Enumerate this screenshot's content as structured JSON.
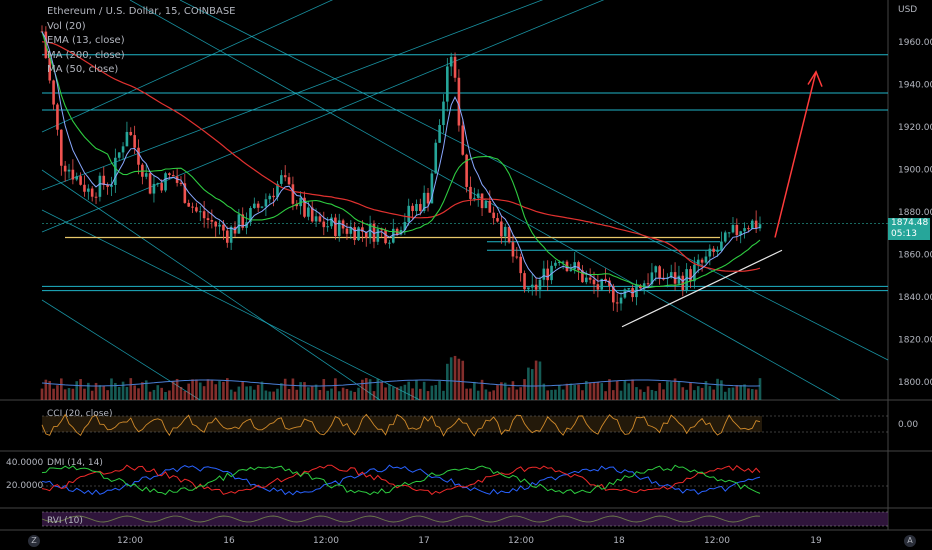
{
  "legend": {
    "symbol": "Ethereum / U.S. Dollar, 15, COINBASE",
    "vol": "Vol (20)",
    "ema": "EMA (13, close)",
    "ma200": "MA (200, close)",
    "ma50": "MA (50, close)"
  },
  "indicators": {
    "cci": "CCI (20, close)",
    "dmi": "DMI (14, 14)",
    "rvi": "RVI (10)",
    "cci_value": "0.00",
    "dmi_top": "40.0000",
    "dmi_mid": "20.0000"
  },
  "price_tag": {
    "price": "1874.48",
    "countdown": "05:13"
  },
  "corner_left": "Z",
  "corner_right": "A",
  "colors": {
    "up": "#26a69a",
    "down": "#ef5350",
    "ema": "#89a8ff",
    "ma200": "#e0312f",
    "ma50": "#2ecc40",
    "channel": "#1fb5c8",
    "support": "#e8c86a",
    "arrow": "#ff3b3b"
  },
  "chart_data": {
    "type": "candlestick",
    "title": "Ethereum / U.S. Dollar, 15, COINBASE",
    "currency": "USD",
    "y_ticks": [
      1960,
      1940,
      1920,
      1900,
      1880,
      1860,
      1840,
      1820,
      1800
    ],
    "ylim": [
      1790,
      1968
    ],
    "x_ticks": [
      "12:00",
      "16",
      "12:00",
      "17",
      "12:00",
      "18",
      "12:00",
      "19"
    ],
    "last_price": 1874.48,
    "approx_path": [
      {
        "t": 0,
        "price": 1965
      },
      {
        "t": 5,
        "price": 1905
      },
      {
        "t": 12,
        "price": 1890
      },
      {
        "t": 18,
        "price": 1895
      },
      {
        "t": 22,
        "price": 1920
      },
      {
        "t": 28,
        "price": 1892
      },
      {
        "t": 34,
        "price": 1897
      },
      {
        "t": 40,
        "price": 1880
      },
      {
        "t": 48,
        "price": 1870
      },
      {
        "t": 55,
        "price": 1880
      },
      {
        "t": 62,
        "price": 1895
      },
      {
        "t": 70,
        "price": 1875
      },
      {
        "t": 80,
        "price": 1872
      },
      {
        "t": 90,
        "price": 1870
      },
      {
        "t": 100,
        "price": 1888
      },
      {
        "t": 106,
        "price": 1955
      },
      {
        "t": 110,
        "price": 1893
      },
      {
        "t": 118,
        "price": 1878
      },
      {
        "t": 126,
        "price": 1840
      },
      {
        "t": 134,
        "price": 1860
      },
      {
        "t": 142,
        "price": 1846
      },
      {
        "t": 150,
        "price": 1840
      },
      {
        "t": 158,
        "price": 1850
      },
      {
        "t": 166,
        "price": 1848
      },
      {
        "t": 174,
        "price": 1860
      },
      {
        "t": 182,
        "price": 1875
      },
      {
        "t": 186,
        "price": 1874.48
      }
    ],
    "horizontal_levels": [
      1954,
      1936,
      1928,
      1845,
      1843
    ],
    "support_level": 1868,
    "resistance_box": [
      1862,
      1866
    ],
    "projection_arrow": {
      "from": 1868,
      "to": 1946
    },
    "panes": [
      "CCI (20, close)",
      "DMI (14, 14)",
      "RVI (10)"
    ]
  }
}
